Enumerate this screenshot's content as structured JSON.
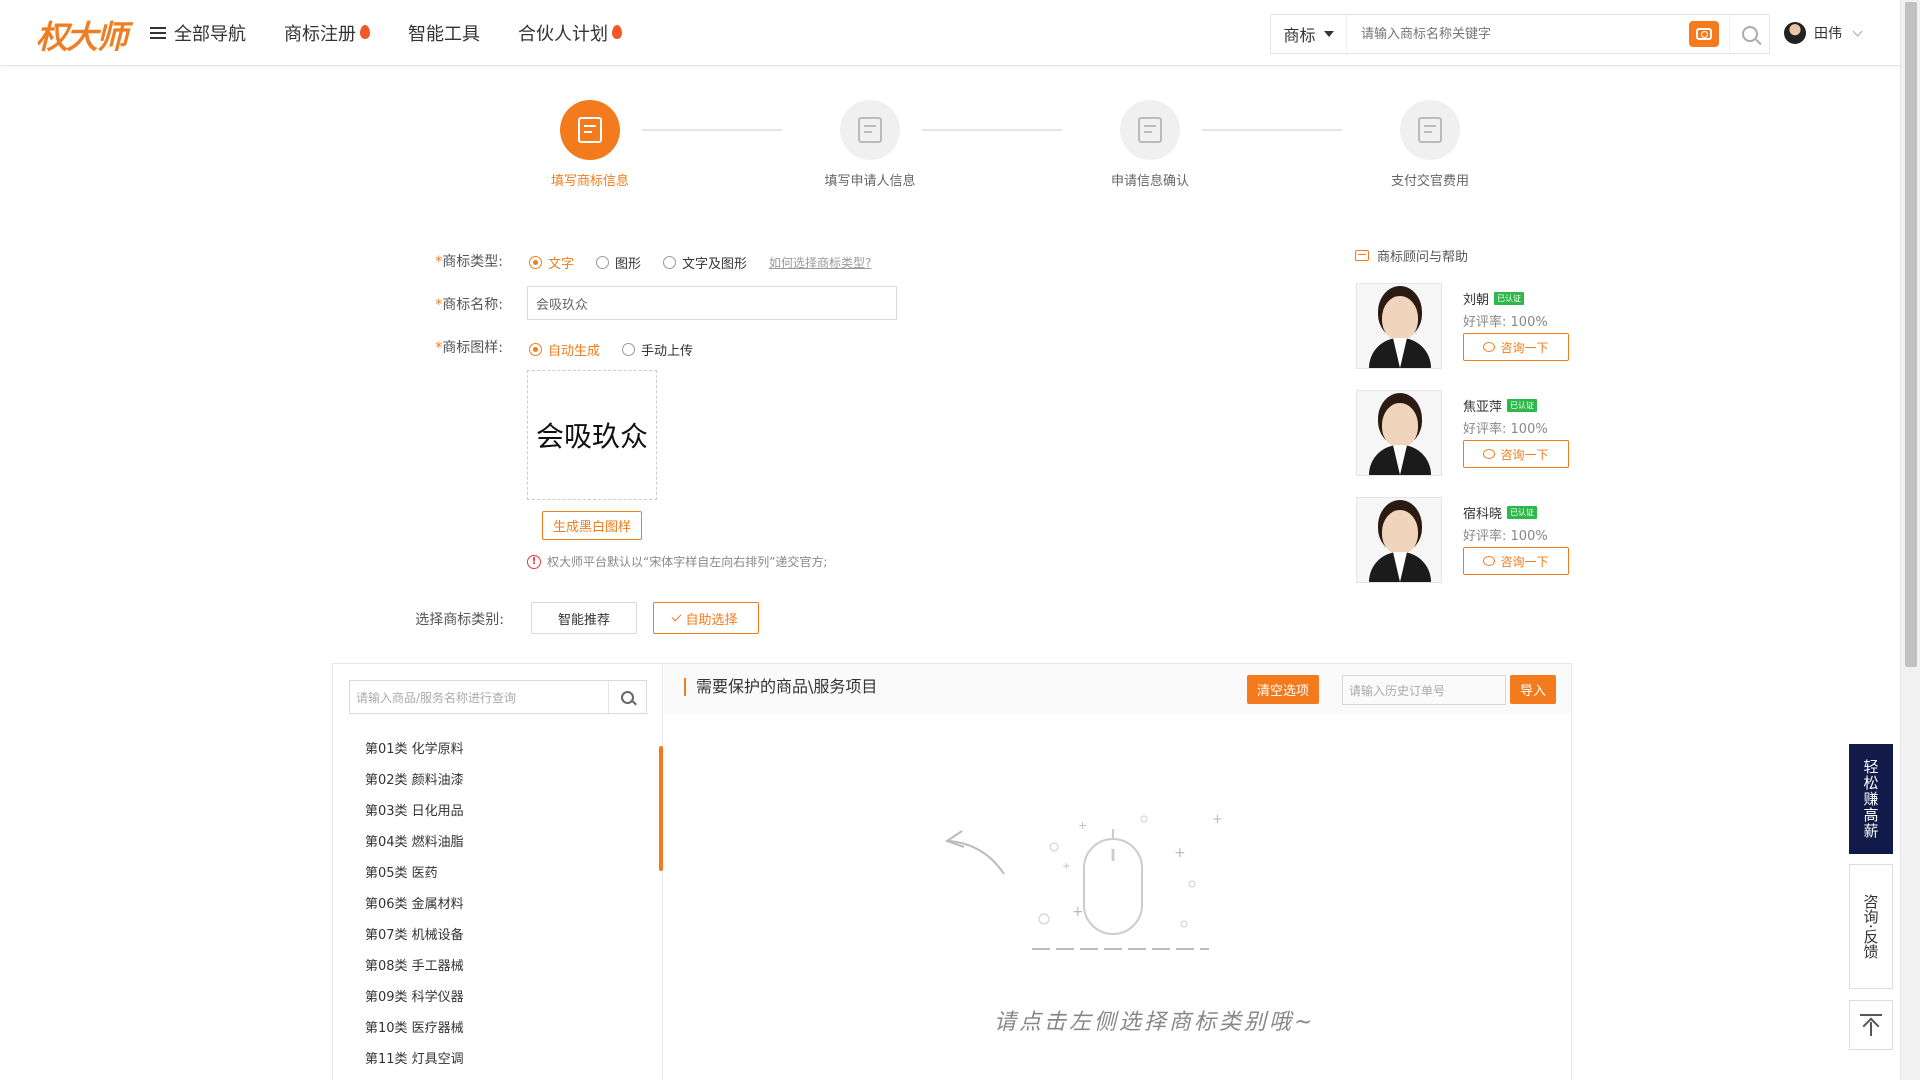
{
  "header": {
    "logo": "权大师",
    "nav": [
      {
        "label": "全部导航",
        "icon": "menu-icon"
      },
      {
        "label": "商标注册",
        "icon": "fire-icon"
      },
      {
        "label": "智能工具"
      },
      {
        "label": "合伙人计划",
        "icon": "fire-icon"
      }
    ],
    "search": {
      "type": "商标",
      "placeholder": "请输入商标名称关键字"
    },
    "user": {
      "name": "田伟"
    }
  },
  "steps": [
    {
      "label": "填写商标信息",
      "active": true
    },
    {
      "label": "填写申请人信息",
      "active": false
    },
    {
      "label": "申请信息确认",
      "active": false
    },
    {
      "label": "支付交官费用",
      "active": false
    }
  ],
  "form": {
    "type_label": "商标类型:",
    "type_options": [
      "文字",
      "图形",
      "文字及图形"
    ],
    "type_selected": "文字",
    "type_help": "如何选择商标类型?",
    "name_label": "商标名称:",
    "name_value": "会吸玖众",
    "sample_label": "商标图样:",
    "sample_options": [
      "自动生成",
      "手动上传"
    ],
    "sample_selected": "自动生成",
    "sample_text": "会吸玖众",
    "bw_button": "生成黑白图样",
    "notice": "权大师平台默认以“宋体字样自左向右排列”递交官方;",
    "category_label": "选择商标类别:",
    "smart_button": "智能推荐",
    "self_button": "自助选择"
  },
  "consult": {
    "title": "商标顾问与帮助",
    "verified_label": "已认证",
    "rate_label": "好评率:",
    "button": "咨询一下",
    "people": [
      {
        "name": "刘朝",
        "rate": "100%"
      },
      {
        "name": "焦亚萍",
        "rate": "100%"
      },
      {
        "name": "宿科晓",
        "rate": "100%"
      }
    ]
  },
  "panel": {
    "search_placeholder": "请输入商品/服务名称进行查询",
    "categories": [
      "第01类 化学原料",
      "第02类 颜料油漆",
      "第03类 日化用品",
      "第04类 燃料油脂",
      "第05类 医药",
      "第06类 金属材料",
      "第07类 机械设备",
      "第08类 手工器械",
      "第09类 科学仪器",
      "第10类 医疗器械",
      "第11类 灯具空调"
    ],
    "title": "需要保护的商品\\服务项目",
    "clear_button": "清空选项",
    "order_placeholder": "请输入历史订单号",
    "import_button": "导入",
    "empty_hint": "请点击左侧选择商标类别哦~"
  },
  "floating": {
    "earn": "轻松赚高薪",
    "feedback": "咨询·反馈"
  },
  "colors": {
    "accent": "#f37b1d",
    "navy": "#121a4a",
    "verified": "#2eb84b"
  }
}
